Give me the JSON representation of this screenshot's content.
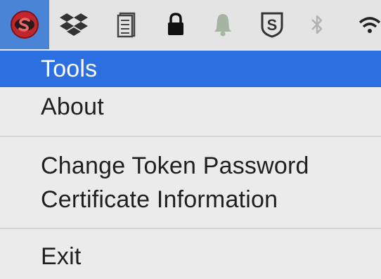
{
  "menubar": {
    "icons": [
      {
        "name": "s-token-app-icon",
        "active": true
      },
      {
        "name": "dropbox-icon"
      },
      {
        "name": "clipboard-icon"
      },
      {
        "name": "lock-icon"
      },
      {
        "name": "bell-icon"
      },
      {
        "name": "s-shield-icon"
      },
      {
        "name": "bluetooth-icon"
      },
      {
        "name": "wifi-icon"
      }
    ]
  },
  "menu": {
    "items": [
      {
        "label": "Tools",
        "highlighted": true
      },
      {
        "label": "About"
      },
      {
        "label": "Change Token Password"
      },
      {
        "label": "Certificate Information"
      },
      {
        "label": "Exit"
      }
    ]
  },
  "colors": {
    "highlight": "#2c6fe1",
    "menu_background": "#ebebeb",
    "menubar_background": "#e4e4e4",
    "app_icon_red": "#c0262b"
  }
}
